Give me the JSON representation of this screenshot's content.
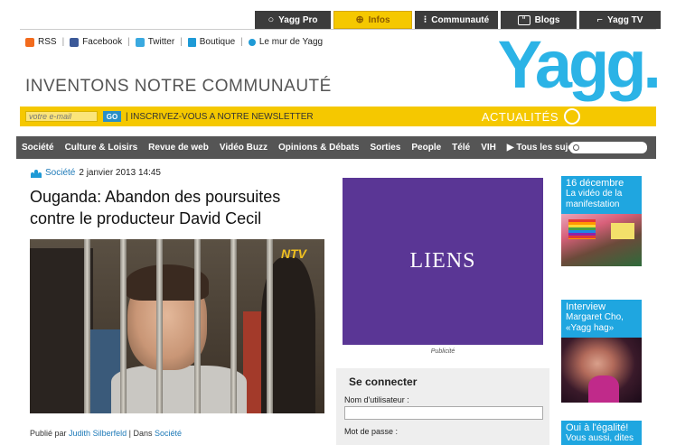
{
  "top_tabs": [
    {
      "label": "Yagg Pro",
      "icon": "circle-icon"
    },
    {
      "label": "Infos",
      "icon": "globe-icon",
      "active": true
    },
    {
      "label": "Communauté",
      "icon": "people-icon"
    },
    {
      "label": "Blogs",
      "icon": "quote-icon"
    },
    {
      "label": "Yagg TV",
      "icon": "tv-icon"
    }
  ],
  "social": {
    "rss": "RSS",
    "facebook": "Facebook",
    "twitter": "Twitter",
    "boutique": "Boutique",
    "mur": "Le mur de Yagg"
  },
  "tagline": "INVENTONS NOTRE COMMUNAUTÉ",
  "logo": "Yagg.",
  "newsletter": {
    "placeholder": "votre e-mail",
    "go_label": "GO",
    "text": "| INSCRIVEZ-VOUS A NOTRE NEWSLETTER",
    "section": "ACTUALITÉS"
  },
  "nav": [
    "Société",
    "Culture & Loisirs",
    "Revue de web",
    "Vidéo Buzz",
    "Opinions & Débats",
    "Sorties",
    "People",
    "Télé",
    "VIH",
    "▶ Tous les sujets"
  ],
  "article": {
    "category": "Société",
    "date": "2 janvier 2013 14:45",
    "title": "Ouganda: Abandon des poursuites contre le producteur David Cecil",
    "photo_logo": "NTV",
    "byline_prefix": "Publié par",
    "author": "Judith Silberfeld",
    "byline_sep": "|  Dans",
    "byline_category": "Société"
  },
  "ad": {
    "label": "LIENS",
    "caption": "Publicité"
  },
  "login": {
    "title": "Se connecter",
    "username_label": "Nom d'utilisateur :",
    "password_label": "Mot de passe :"
  },
  "promos": [
    {
      "kicker": "16 décembre",
      "text": "La vidéo de la manifestation"
    },
    {
      "kicker": "Interview",
      "text": "Margaret Cho, «Yagg hag»"
    },
    {
      "kicker": "Oui à l'égalité!",
      "text": "Vous aussi, dites"
    }
  ],
  "colors": {
    "accent_blue": "#1fa6e0",
    "yellow": "#f5c800",
    "nav_gray": "#555555",
    "ad_purple": "#5a3695"
  }
}
